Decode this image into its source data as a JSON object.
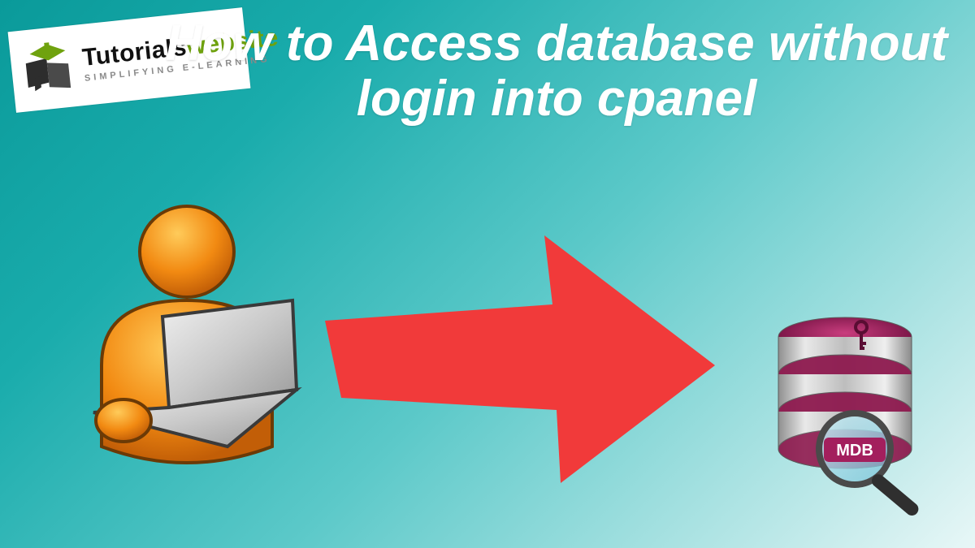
{
  "logo": {
    "brand_part1": "Tutorials",
    "brand_part2": "website",
    "tagline": "SIMPLIFYING E-LEARNING"
  },
  "title": "How to Access database without login into cpanel",
  "db": {
    "badge": "MDB"
  },
  "icons": {
    "user_laptop": "user-laptop-icon",
    "arrow": "arrow-right-icon",
    "database": "database-icon",
    "magnifier": "magnifier-icon",
    "key": "key-icon",
    "logo_mark": "book-cap-icon"
  },
  "colors": {
    "arrow": "#f13a3a",
    "user_body": "#f28a12",
    "laptop": "#bfbfbf",
    "db_top": "#8e1a4f",
    "db_side": "#d6d6d6",
    "badge_bg": "#a31f5d",
    "title": "#ffffff"
  }
}
